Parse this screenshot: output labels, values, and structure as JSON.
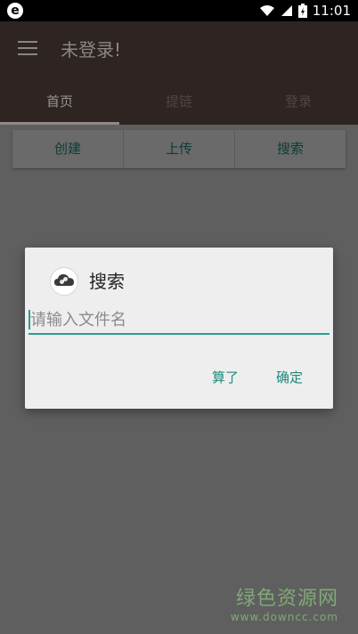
{
  "status_bar": {
    "app_icon_glyph": "e",
    "time": "11:01",
    "icons": [
      "wifi-icon",
      "signal-icon",
      "battery-icon"
    ]
  },
  "toolbar": {
    "title": "未登录!",
    "menu_icon": "hamburger-menu-icon"
  },
  "tabs": [
    {
      "label": "首页",
      "active": true
    },
    {
      "label": "提链",
      "active": false
    },
    {
      "label": "登录",
      "active": false
    }
  ],
  "actions": {
    "create": "创建",
    "upload": "上传",
    "search": "搜索"
  },
  "dialog": {
    "icon": "cloud-link-icon",
    "title": "搜索",
    "input_placeholder": "请输入文件名",
    "input_value": "",
    "cancel_label": "算了",
    "confirm_label": "确定"
  },
  "watermark": {
    "name": "绿色资源网",
    "url": "www.downcc.com"
  },
  "colors": {
    "toolbar_bg": "#2e2421",
    "overlay_bg": "#5f5f5f",
    "accent": "#2a9d8f",
    "dialog_bg": "#eeeeee"
  }
}
